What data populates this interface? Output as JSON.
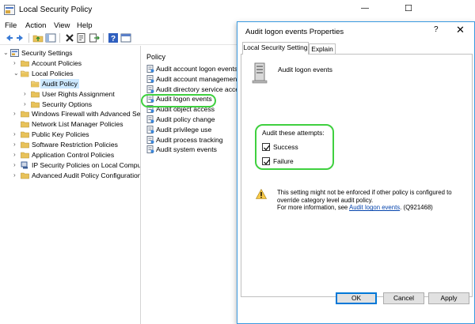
{
  "window": {
    "title": "Local Security Policy",
    "controls": {
      "minimize": "—",
      "maximize": "☐",
      "close": "✕"
    }
  },
  "menu": {
    "items": [
      "File",
      "Action",
      "View",
      "Help"
    ]
  },
  "toolbar": {
    "icons": [
      "back-arrow-icon",
      "forward-arrow-icon",
      "folder-up-icon",
      "show-hide-tree-icon",
      "delete-icon",
      "properties-icon",
      "export-list-icon",
      "help-icon",
      "mmc-console-icon"
    ]
  },
  "tree": {
    "items": [
      {
        "label": "Security Settings",
        "level": 0,
        "expander": "⌄",
        "icon": "security-settings-icon"
      },
      {
        "label": "Account Policies",
        "level": 1,
        "expander": "›",
        "icon": "folder-icon"
      },
      {
        "label": "Local Policies",
        "level": 1,
        "expander": "⌄",
        "icon": "folder-open-icon"
      },
      {
        "label": "Audit Policy",
        "level": 2,
        "expander": "",
        "icon": "folder-open-icon",
        "selected": true
      },
      {
        "label": "User Rights Assignment",
        "level": 2,
        "expander": "›",
        "icon": "folder-icon"
      },
      {
        "label": "Security Options",
        "level": 2,
        "expander": "›",
        "icon": "folder-icon"
      },
      {
        "label": "Windows Firewall with Advanced Sec",
        "level": 1,
        "expander": "›",
        "icon": "folder-icon"
      },
      {
        "label": "Network List Manager Policies",
        "level": 1,
        "expander": "",
        "icon": "folder-icon"
      },
      {
        "label": "Public Key Policies",
        "level": 1,
        "expander": "›",
        "icon": "folder-icon"
      },
      {
        "label": "Software Restriction Policies",
        "level": 1,
        "expander": "›",
        "icon": "folder-icon"
      },
      {
        "label": "Application Control Policies",
        "level": 1,
        "expander": "›",
        "icon": "folder-icon"
      },
      {
        "label": "IP Security Policies on Local Compute",
        "level": 1,
        "expander": "›",
        "icon": "ipsec-icon"
      },
      {
        "label": "Advanced Audit Policy Configuration",
        "level": 1,
        "expander": "›",
        "icon": "folder-icon"
      }
    ]
  },
  "policy_list": {
    "header": "Policy",
    "items": [
      "Audit account logon events",
      "Audit account management",
      "Audit directory service access",
      "Audit logon events",
      "Audit object access",
      "Audit policy change",
      "Audit privilege use",
      "Audit process tracking",
      "Audit system events"
    ]
  },
  "dialog": {
    "title": "Audit logon events Properties",
    "help": "?",
    "close": "✕",
    "tabs": [
      {
        "label": "Local Security Setting",
        "active": true
      },
      {
        "label": "Explain",
        "active": false
      }
    ],
    "policy_name": "Audit logon events",
    "attempts_label": "Audit these attempts:",
    "checkboxes": [
      {
        "label": "Success",
        "checked": true
      },
      {
        "label": "Failure",
        "checked": true
      }
    ],
    "warning": {
      "line1": "This setting might not be enforced if other policy is configured to override category level audit policy.",
      "line2_prefix": "For more information, see ",
      "link": "Audit logon events",
      "line2_suffix": ". (Q921468)"
    },
    "buttons": {
      "ok": "OK",
      "cancel": "Cancel",
      "apply": "Apply"
    }
  },
  "colors": {
    "highlight": "#3fd03f",
    "selection": "#cce8ff",
    "accent": "#0078d7"
  }
}
